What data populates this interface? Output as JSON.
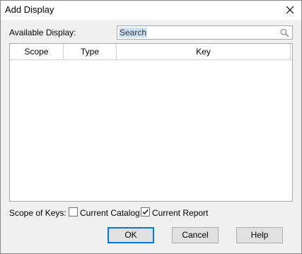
{
  "window": {
    "title": "Add Display"
  },
  "available": {
    "label": "Available Display:",
    "search_value": "Search"
  },
  "table": {
    "columns": [
      "Scope",
      "Type",
      "Key"
    ],
    "rows": []
  },
  "scope": {
    "label": "Scope of Keys:",
    "current_catalog": {
      "label": "Current Catalog",
      "checked": false
    },
    "current_report": {
      "label": "Current Report",
      "checked": true
    }
  },
  "buttons": {
    "ok": "OK",
    "cancel": "Cancel",
    "help": "Help"
  },
  "icons": {
    "close": "close-icon",
    "search": "search-icon",
    "check": "check-icon"
  },
  "colors": {
    "accent": "#0078d7",
    "selection": "#cde1f7"
  }
}
